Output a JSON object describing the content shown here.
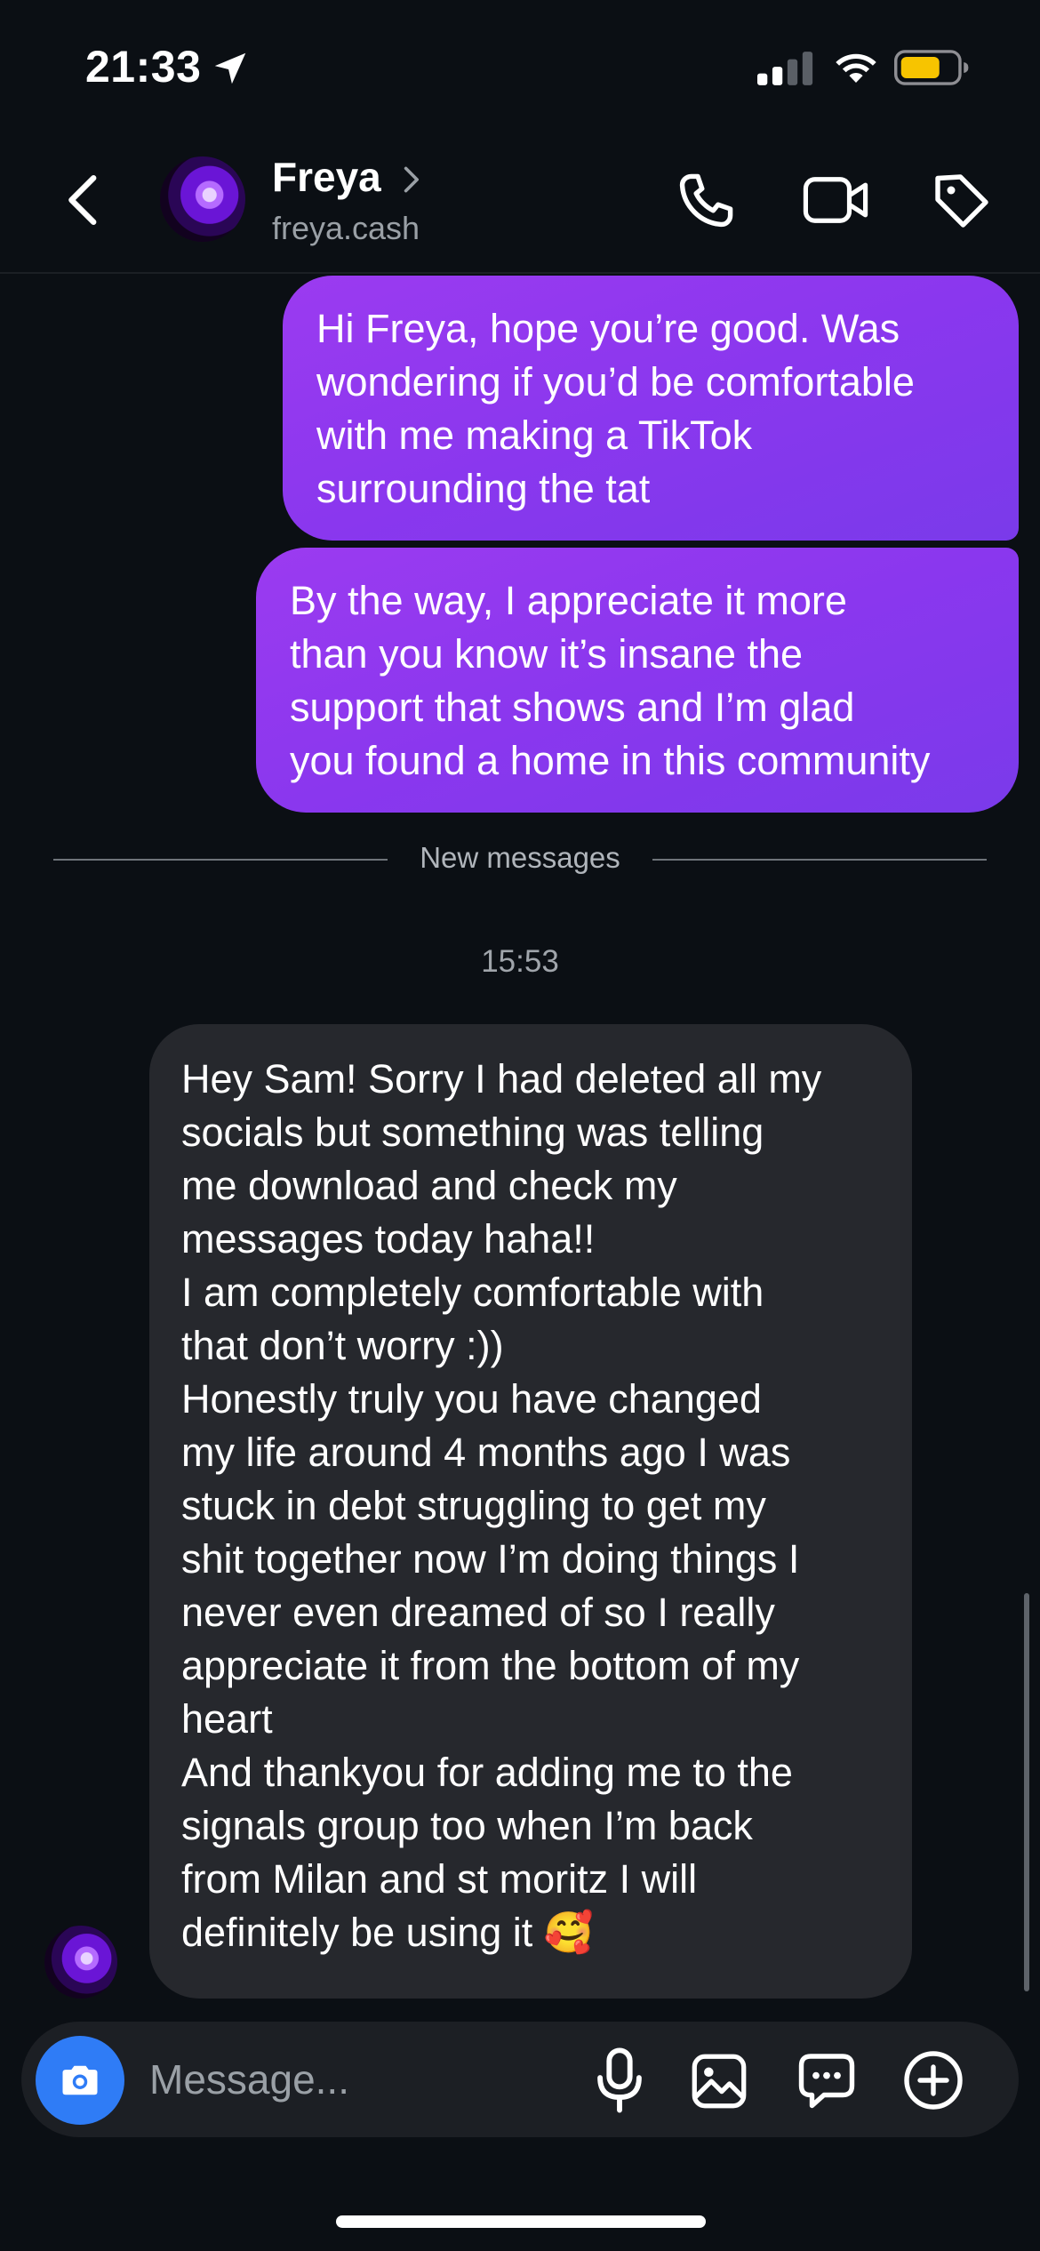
{
  "status_bar": {
    "time": "21:33",
    "battery_color": "#f7c400"
  },
  "header": {
    "contact_name": "Freya",
    "contact_username": "freya.cash"
  },
  "thread": {
    "outgoing": [
      {
        "lines": [
          "Hi Freya, hope you’re good. Was",
          "wondering if you’d be comfortable",
          "with me making a TikTok",
          "surrounding the tat"
        ]
      },
      {
        "lines": [
          "By the way, I appreciate it more",
          "than you know it’s insane the",
          "support that shows and I’m glad",
          "you found a home in this community"
        ]
      }
    ],
    "new_messages_label": "New messages",
    "timestamp": "15:53",
    "incoming": {
      "lines": [
        "Hey Sam! Sorry I had deleted all my",
        "socials but something was telling",
        "me download and check my",
        "messages today haha!!",
        "I am completely comfortable with",
        "that don’t worry :))",
        "Honestly truly you have changed",
        "my life around 4 months ago I was",
        "stuck in debt struggling to get my",
        "shit together now I’m doing things I",
        "never even dreamed of so I really",
        "appreciate it from the bottom of my",
        "heart",
        "And thankyou for adding me to the",
        "signals group too when I’m back",
        "from Milan and st moritz I will",
        "definitely be using it 🥰"
      ]
    }
  },
  "composer": {
    "placeholder": "Message..."
  },
  "colors": {
    "outgoing_bubble": "#8a37ee",
    "incoming_bubble": "#26282d",
    "camera_button": "#2f7cf6",
    "background": "#0b0f14"
  },
  "icons": [
    "location-arrow-icon",
    "signal-icon",
    "wifi-icon",
    "battery-icon",
    "back-chevron-icon",
    "chevron-right-icon",
    "phone-icon",
    "video-camera-icon",
    "tag-icon",
    "camera-icon",
    "microphone-icon",
    "gallery-icon",
    "sticker-icon",
    "plus-icon"
  ]
}
